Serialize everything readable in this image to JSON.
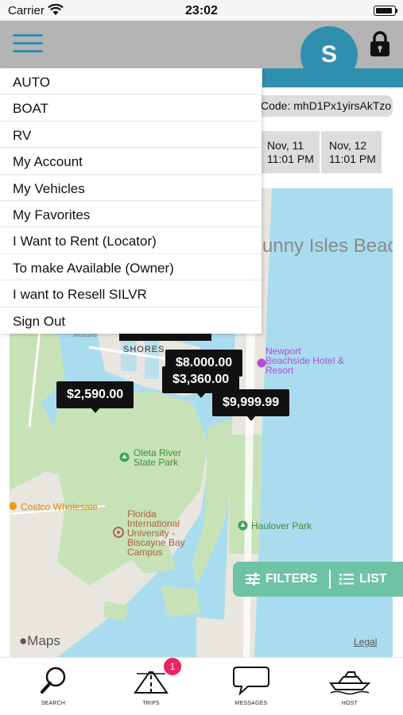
{
  "status_bar": {
    "carrier": "Carrier",
    "time": "23:02"
  },
  "header": {
    "avatar_initial": "S"
  },
  "code": {
    "label": "Code: mhD1Px1yirsAkTzo"
  },
  "dates": [
    {
      "day": "Nov, 11",
      "time": "11:01 PM"
    },
    {
      "day": "Nov, 12",
      "time": "11:01 PM"
    }
  ],
  "menu": {
    "items": [
      "AUTO",
      "BOAT",
      "RV",
      "My Account",
      "My Vehicles",
      "My Favorites",
      "I Want to Rent (Locator)",
      "To make Available (Owner)",
      "I want to Resell SILVR",
      "Sign Out"
    ]
  },
  "map": {
    "price_tags": [
      "$8,000.00",
      "$3,360.00",
      "$2,590.00",
      "$9,999.99"
    ],
    "places": {
      "newport": "Newport Beachside Hotel & Resort",
      "oleta": "Oleta River State Park",
      "costco": "Costco Wholesale",
      "fiu": "Florida International University - Biscayne Bay Campus",
      "haulover": "Haulover Park",
      "shores": "SHORES",
      "maule": "Maule",
      "sunny_isles": "Sunny Isles Beach"
    },
    "attribution": "Maps",
    "legal": "Legal"
  },
  "filter_bar": {
    "filters_label": "FILTERS",
    "list_label": "LIST"
  },
  "tabs": [
    {
      "label": "SEARCH",
      "icon": "magnifier-icon"
    },
    {
      "label": "TRIPS",
      "icon": "road-icon",
      "badge": "1"
    },
    {
      "label": "MESSAGES",
      "icon": "speech-bubble-icon"
    },
    {
      "label": "HOST",
      "icon": "yacht-icon"
    }
  ],
  "colors": {
    "teal": "#2f8fae",
    "header_gray": "#b3b3b3",
    "filter_green": "#6fc3a5",
    "badge_pink": "#e8265f",
    "water": "#aadcef",
    "land": "#c8e2b8"
  }
}
